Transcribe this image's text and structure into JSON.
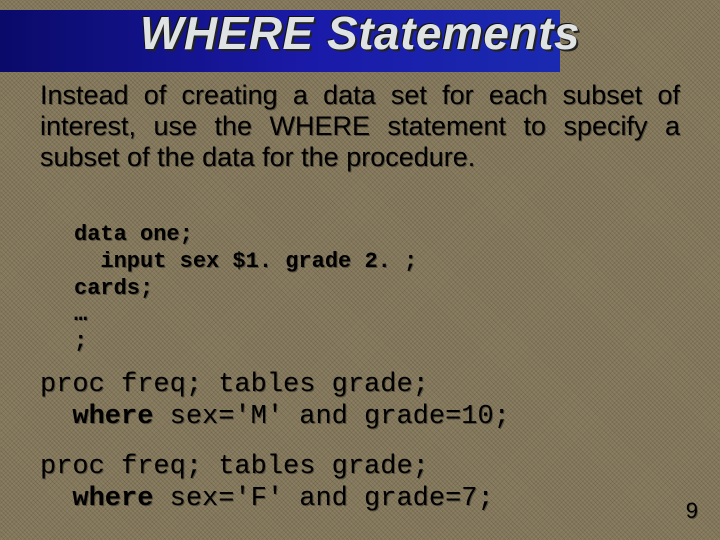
{
  "title": "WHERE Statements",
  "paragraph": "Instead of creating a data set for each subset of interest, use the WHERE statement to specify a subset of the data for the procedure.",
  "code_small": {
    "l1": "data one;",
    "l2": "  input sex $1. grade 2. ;",
    "l3": "cards;",
    "l4": "…",
    "l5": ";"
  },
  "code_block_1": {
    "prefix1": "proc freq; tables grade;",
    "indent2": "  ",
    "kw2": "where",
    "rest2": " sex='M' and grade=10;"
  },
  "code_block_2": {
    "prefix1": "proc freq; tables grade;",
    "indent2": "  ",
    "kw2": "where",
    "rest2": " sex='F' and grade=7;"
  },
  "page_number": "9"
}
